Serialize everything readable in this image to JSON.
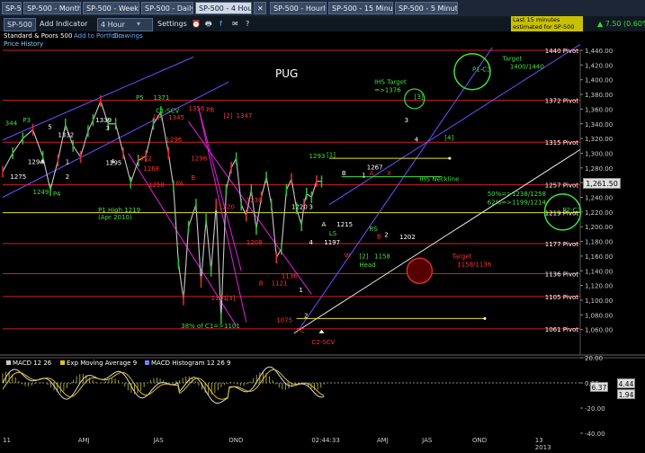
{
  "tabs": [
    {
      "label": "SP-500",
      "x": 2,
      "w": 22
    },
    {
      "label": "SP-500 - Monthly",
      "x": 26,
      "w": 64
    },
    {
      "label": "SP-500 - Weekly",
      "x": 92,
      "w": 63
    },
    {
      "label": "SP-500 - Daily",
      "x": 157,
      "w": 58
    },
    {
      "label": "SP-500 - 4 Hour",
      "x": 217,
      "w": 63,
      "active": true
    },
    {
      "label": "SP-500 - Hourly",
      "x": 300,
      "w": 63
    },
    {
      "label": "SP-500 - 15 Minute",
      "x": 365,
      "w": 72
    },
    {
      "label": "SP-500 - 5 Minute",
      "x": 439,
      "w": 70
    }
  ],
  "toolbar": {
    "symbol": "SP-500",
    "add_indicator": "Add Indicator",
    "timeframe": "4 Hour",
    "settings": "Settings",
    "change": "7.50 (0.60%)",
    "delay_note": "Last 15 minutes estimated for SP-500",
    "symbol_name": "Standard & Poors 500",
    "add_portfolio": "Add to Portfolio",
    "drawings": "Drawings",
    "price_history": "Price History"
  },
  "chart_data": {
    "type": "line",
    "title": "PUG",
    "xlim_months": [
      0,
      23
    ],
    "x_tick_labels": [
      {
        "label": "11",
        "m": 0
      },
      {
        "label": "AMJ",
        "m": 3
      },
      {
        "label": "JAS",
        "m": 6
      },
      {
        "label": "OND",
        "m": 9
      },
      {
        "label": "02:44:33",
        "m": 12.3
      },
      {
        "label": "AMJ",
        "m": 14.9
      },
      {
        "label": "JAS",
        "m": 16.7
      },
      {
        "label": "OND",
        "m": 18.7
      },
      {
        "label": "13",
        "m": 21.2
      },
      {
        "label": "2013",
        "m": 21.2
      }
    ],
    "ylim": [
      1040,
      1440
    ],
    "y_ticks": [
      1060,
      1080,
      1100,
      1120,
      1140,
      1160,
      1180,
      1200,
      1220,
      1240,
      1260,
      1280,
      1300,
      1320,
      1340,
      1360,
      1380,
      1400,
      1420,
      1440
    ],
    "last_price": "1,261.50",
    "series": [
      {
        "name": "SP-500",
        "color": "#c8c8c8",
        "x": [
          0,
          0.4,
          0.8,
          1.2,
          1.6,
          1.9,
          2.2,
          2.5,
          2.8,
          3.1,
          3.4,
          3.6,
          3.9,
          4.2,
          4.5,
          4.8,
          5.1,
          5.4,
          5.7,
          6.0,
          6.3,
          6.6,
          6.8,
          7.0,
          7.2,
          7.4,
          7.7,
          7.9,
          8.1,
          8.3,
          8.5,
          8.7,
          8.9,
          9.1,
          9.3,
          9.5,
          9.7,
          9.9,
          10.1,
          10.3,
          10.5,
          10.7,
          10.9,
          11.1,
          11.3,
          11.5,
          11.7,
          11.9,
          12.0,
          12.1,
          12.3,
          12.5,
          12.7
        ],
        "y": [
          1275,
          1300,
          1320,
          1332,
          1295,
          1250,
          1290,
          1339,
          1310,
          1295,
          1330,
          1345,
          1371,
          1340,
          1340,
          1300,
          1260,
          1290,
          1296,
          1340,
          1356,
          1300,
          1255,
          1150,
          1101,
          1200,
          1230,
          1125,
          1210,
          1140,
          1230,
          1075,
          1250,
          1280,
          1293,
          1230,
          1215,
          1250,
          1197,
          1240,
          1267,
          1230,
          1158,
          1170,
          1250,
          1265,
          1225,
          1202,
          1230,
          1245,
          1240,
          1262,
          1261.5
        ]
      }
    ],
    "pivots": [
      {
        "label": "1440 Pivot",
        "y": 1440
      },
      {
        "label": "1372 Pivot",
        "y": 1372
      },
      {
        "label": "1315 Pivot",
        "y": 1315
      },
      {
        "label": "1257 Pivot",
        "y": 1257
      },
      {
        "label": "1219 Pivot",
        "y": 1219
      },
      {
        "label": "1177 Pivot",
        "y": 1177
      },
      {
        "label": "1136 Pivot",
        "y": 1136
      },
      {
        "label": "1105 Pivot",
        "y": 1105
      },
      {
        "label": "1061 Pivot",
        "y": 1061
      }
    ],
    "annotations": [
      {
        "text": "P3",
        "m": 0.8,
        "y": 1342,
        "color": "#40e040"
      },
      {
        "text": "344",
        "m": 0.1,
        "y": 1338,
        "color": "#40e040"
      },
      {
        "text": "5",
        "m": 1.8,
        "y": 1333,
        "color": "#ffffff"
      },
      {
        "text": "P5",
        "m": 5.3,
        "y": 1373,
        "color": "#40e040"
      },
      {
        "text": "1371",
        "m": 6.0,
        "y": 1373,
        "color": "#40e040"
      },
      {
        "text": "C1-SCV",
        "m": 6.1,
        "y": 1355,
        "color": "#40e040"
      },
      {
        "text": "1339",
        "m": 3.7,
        "y": 1342,
        "color": "#ffffff"
      },
      {
        "text": "3",
        "m": 4.1,
        "y": 1331,
        "color": "#ffffff"
      },
      {
        "text": "1332",
        "m": 2.2,
        "y": 1322,
        "color": "#ffffff"
      },
      {
        "text": "1294",
        "m": 1.0,
        "y": 1285,
        "color": "#ffffff"
      },
      {
        "text": "A",
        "m": 1.5,
        "y": 1285,
        "color": "#ffffff"
      },
      {
        "text": "1",
        "m": 2.5,
        "y": 1285,
        "color": "#ffffff"
      },
      {
        "text": "1295",
        "m": 4.1,
        "y": 1284,
        "color": "#ffffff"
      },
      {
        "text": "4",
        "m": 4.3,
        "y": 1286,
        "color": "#ffffff"
      },
      {
        "text": "1275",
        "m": 0.3,
        "y": 1265,
        "color": "#ffffff"
      },
      {
        "text": "2",
        "m": 2.5,
        "y": 1265,
        "color": "#ffffff"
      },
      {
        "text": "1249",
        "m": 1.2,
        "y": 1244,
        "color": "#40e040"
      },
      {
        "text": "P4",
        "m": 2.0,
        "y": 1242,
        "color": "#40e040"
      },
      {
        "text": "1356",
        "m": 7.4,
        "y": 1358,
        "color": "#ff3030"
      },
      {
        "text": "PB",
        "m": 8.1,
        "y": 1356,
        "color": "#ff3030"
      },
      {
        "text": "[2]",
        "m": 8.8,
        "y": 1348,
        "color": "#ff3030"
      },
      {
        "text": "1347",
        "m": 9.3,
        "y": 1348,
        "color": "#ff3030"
      },
      {
        "text": "[2]",
        "m": 6.0,
        "y": 1346,
        "color": "#ff3030"
      },
      {
        "text": "1345",
        "m": 6.6,
        "y": 1346,
        "color": "#ff3030"
      },
      {
        "text": "1296",
        "m": 6.5,
        "y": 1316,
        "color": "#ff3030"
      },
      {
        "text": "1312",
        "m": 5.3,
        "y": 1290,
        "color": "#ff3030"
      },
      {
        "text": "1296",
        "m": 7.5,
        "y": 1290,
        "color": "#ff3030"
      },
      {
        "text": "1268",
        "m": 5.6,
        "y": 1276,
        "color": "#ff3030"
      },
      {
        "text": "1258",
        "m": 5.8,
        "y": 1254,
        "color": "#ff3030"
      },
      {
        "text": "PA",
        "m": 6.9,
        "y": 1256,
        "color": "#ff3030"
      },
      {
        "text": "B",
        "m": 7.5,
        "y": 1264,
        "color": "#ff3030"
      },
      {
        "text": "P1 High 1219",
        "m": 3.8,
        "y": 1220,
        "color": "#40e040"
      },
      {
        "text": "(Apr 2010)",
        "m": 3.8,
        "y": 1210,
        "color": "#40e040"
      },
      {
        "text": "1220",
        "m": 8.6,
        "y": 1224,
        "color": "#ff3030"
      },
      {
        "text": "1230",
        "m": 9.7,
        "y": 1233,
        "color": "#ff3030"
      },
      {
        "text": "1208",
        "m": 9.7,
        "y": 1176,
        "color": "#ff3030"
      },
      {
        "text": "B",
        "m": 10.2,
        "y": 1120,
        "color": "#ff3030"
      },
      {
        "text": "1121",
        "m": 10.7,
        "y": 1120,
        "color": "#ff3030"
      },
      {
        "text": "1136",
        "m": 11.1,
        "y": 1130,
        "color": "#ff3030"
      },
      {
        "text": "1101",
        "m": 8.3,
        "y": 1100,
        "color": "#ff3030"
      },
      {
        "text": "[3]",
        "m": 8.9,
        "y": 1100,
        "color": "#ff3030"
      },
      {
        "text": "1220",
        "m": 11.5,
        "y": 1224,
        "color": "#ffffff"
      },
      {
        "text": "3",
        "m": 12.2,
        "y": 1224,
        "color": "#ffffff"
      },
      {
        "text": "1293",
        "m": 12.2,
        "y": 1293,
        "color": "#40e040"
      },
      {
        "text": "[1]",
        "m": 12.9,
        "y": 1295,
        "color": "#40e040"
      },
      {
        "text": "B",
        "m": 13.5,
        "y": 1270,
        "color": "#ffffff"
      },
      {
        "text": "1267",
        "m": 14.5,
        "y": 1278,
        "color": "#ffffff"
      },
      {
        "text": "A",
        "m": 14.6,
        "y": 1270,
        "color": "#ff3030"
      },
      {
        "text": "X",
        "m": 15.3,
        "y": 1270,
        "color": "#ff3030"
      },
      {
        "text": "1",
        "m": 14.3,
        "y": 1267,
        "color": "#ffffff"
      },
      {
        "text": "A",
        "m": 12.7,
        "y": 1200,
        "color": "#ffffff"
      },
      {
        "text": "1215",
        "m": 13.3,
        "y": 1200,
        "color": "#ffffff"
      },
      {
        "text": "LS",
        "m": 13.0,
        "y": 1188,
        "color": "#40e040"
      },
      {
        "text": "4",
        "m": 12.2,
        "y": 1176,
        "color": "#ffffff"
      },
      {
        "text": "1197",
        "m": 12.8,
        "y": 1176,
        "color": "#ffffff"
      },
      {
        "text": "RS",
        "m": 14.6,
        "y": 1194,
        "color": "#40e040"
      },
      {
        "text": "B",
        "m": 14.9,
        "y": 1184,
        "color": "#ff3030"
      },
      {
        "text": "2",
        "m": 15.2,
        "y": 1186,
        "color": "#ffffff"
      },
      {
        "text": "1202",
        "m": 15.8,
        "y": 1183,
        "color": "#ffffff"
      },
      {
        "text": "W",
        "m": 13.6,
        "y": 1158,
        "color": "#ff3030"
      },
      {
        "text": "[2]",
        "m": 14.2,
        "y": 1157,
        "color": "#40e040"
      },
      {
        "text": "1158",
        "m": 14.8,
        "y": 1157,
        "color": "#40e040"
      },
      {
        "text": "Head",
        "m": 14.2,
        "y": 1145,
        "color": "#40e040"
      },
      {
        "text": "1075",
        "m": 10.9,
        "y": 1070,
        "color": "#ff3030"
      },
      {
        "text": "PC",
        "m": 11.7,
        "y": 1056,
        "color": "#ff3030"
      },
      {
        "text": "C2-SCV",
        "m": 12.3,
        "y": 1040,
        "color": "#ff3030"
      },
      {
        "text": "1",
        "m": 11.8,
        "y": 1111,
        "color": "#ffffff"
      },
      {
        "text": "2",
        "m": 12.0,
        "y": 1076,
        "color": "#ffffff"
      },
      {
        "text": "38% of C1=>1101",
        "m": 7.1,
        "y": 1062,
        "color": "#40e040"
      },
      {
        "text": "IHS Neckline",
        "m": 16.6,
        "y": 1262,
        "color": "#40e040"
      },
      {
        "text": "IHS Target",
        "m": 14.8,
        "y": 1394,
        "color": "#40e040"
      },
      {
        "text": "=>1376",
        "m": 14.8,
        "y": 1383,
        "color": "#40e040"
      },
      {
        "text": "[3]",
        "m": 16.4,
        "y": 1374,
        "color": "#40e040"
      },
      {
        "text": "3",
        "m": 16.0,
        "y": 1342,
        "color": "#ffffff"
      },
      {
        "text": "4",
        "m": 16.4,
        "y": 1316,
        "color": "#ffffff"
      },
      {
        "text": "[4]",
        "m": 17.6,
        "y": 1318,
        "color": "#40e040"
      },
      {
        "text": "P1-C3",
        "m": 18.7,
        "y": 1411,
        "color": "#40e040"
      },
      {
        "text": "Target",
        "m": 19.9,
        "y": 1426,
        "color": "#40e040"
      },
      {
        "text": "1400/1440",
        "m": 20.2,
        "y": 1415,
        "color": "#40e040"
      },
      {
        "text": "P2-C3",
        "m": 22.3,
        "y": 1220,
        "color": "#40e040"
      },
      {
        "text": "50%=>1238/1258",
        "m": 19.3,
        "y": 1242,
        "color": "#40e040"
      },
      {
        "text": "62%=>1199/1214",
        "m": 19.3,
        "y": 1230,
        "color": "#40e040"
      },
      {
        "text": "Target",
        "m": 17.9,
        "y": 1157,
        "color": "#ff3030"
      },
      {
        "text": "1158/1136",
        "m": 18.1,
        "y": 1146,
        "color": "#ff3030"
      }
    ],
    "macd": {
      "legend": [
        "MACD 12 26",
        "Exp Moving Average 9",
        "MACD Histogram 12 26 9"
      ],
      "ylim": [
        -40,
        20
      ],
      "y_ticks": [
        20,
        0,
        -20,
        -40
      ],
      "value_a": "6.37",
      "value_b": "4.44",
      "value_c": "1.94"
    },
    "colors": {
      "pivot_red": "#d02020",
      "yellow": "#e0e020",
      "channel_blue": "#7050ff",
      "magenta": "#e020e0",
      "green": "#40e040"
    }
  }
}
